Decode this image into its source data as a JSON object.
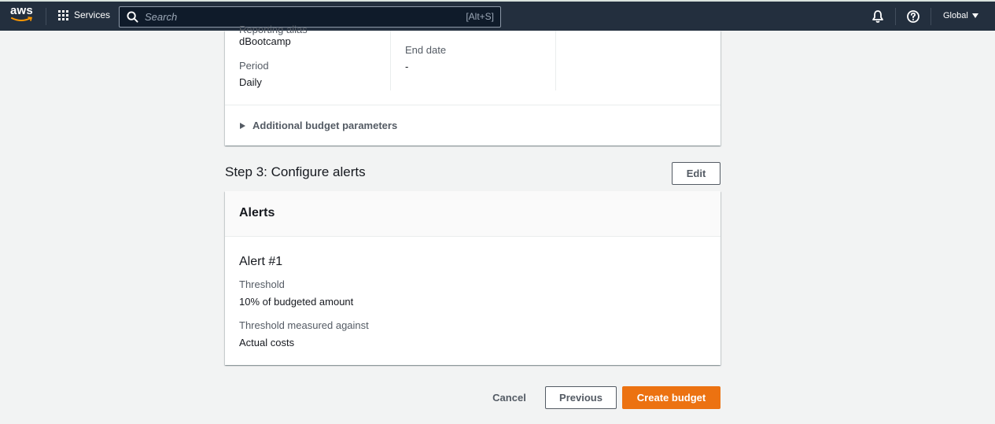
{
  "topnav": {
    "logo_text": "aws",
    "services_label": "Services",
    "search_placeholder": "Search",
    "search_shortcut": "[Alt+S]",
    "region_label": "Global",
    "icons": [
      "grid-icon",
      "search-icon",
      "bell-icon",
      "help-icon",
      "caret-down-icon"
    ]
  },
  "budget_details": {
    "partial_label": "Reporting alias",
    "name_value": "dBootcamp",
    "period_label": "Period",
    "period_value": "Daily",
    "end_date_label": "End date",
    "end_date_value": "-",
    "additional_params_label": "Additional budget parameters"
  },
  "step3": {
    "title": "Step 3: Configure alerts",
    "edit_label": "Edit",
    "alerts_header": "Alerts",
    "alert": {
      "title": "Alert #1",
      "threshold_label": "Threshold",
      "threshold_value": "10% of budgeted amount",
      "measured_label": "Threshold measured against",
      "measured_value": "Actual costs"
    }
  },
  "footer": {
    "cancel_label": "Cancel",
    "previous_label": "Previous",
    "create_label": "Create budget"
  },
  "colors": {
    "nav_bg": "#232f3e",
    "primary_button": "#ec7211",
    "page_bg": "#f2f3f3"
  }
}
